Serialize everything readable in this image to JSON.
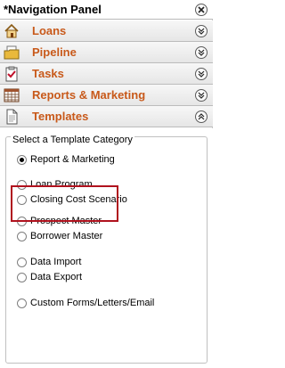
{
  "panel": {
    "title": "*Navigation Panel",
    "close_icon": "close-circle-icon"
  },
  "nav": [
    {
      "label": "Loans",
      "icon": "house-icon",
      "state": "collapsed"
    },
    {
      "label": "Pipeline",
      "icon": "folder-icon",
      "state": "collapsed"
    },
    {
      "label": "Tasks",
      "icon": "checklist-icon",
      "state": "collapsed"
    },
    {
      "label": "Reports & Marketing",
      "icon": "grid-report-icon",
      "state": "collapsed"
    },
    {
      "label": "Templates",
      "icon": "document-icon",
      "state": "expanded"
    }
  ],
  "templates": {
    "group_title": "Select a Template Category",
    "options": [
      {
        "label": "Report & Marketing",
        "checked": true
      },
      {
        "label": "Loan Program",
        "checked": false
      },
      {
        "label": "Closing Cost Scenario",
        "checked": false
      },
      {
        "label": "Prospect Master",
        "checked": false
      },
      {
        "label": "Borrower Master",
        "checked": false
      },
      {
        "label": "Data Import",
        "checked": false
      },
      {
        "label": "Data Export",
        "checked": false
      },
      {
        "label": "Custom Forms/Letters/Email",
        "checked": false
      }
    ]
  },
  "colors": {
    "nav_label": "#c8591a",
    "highlight_box": "#b0121e"
  }
}
